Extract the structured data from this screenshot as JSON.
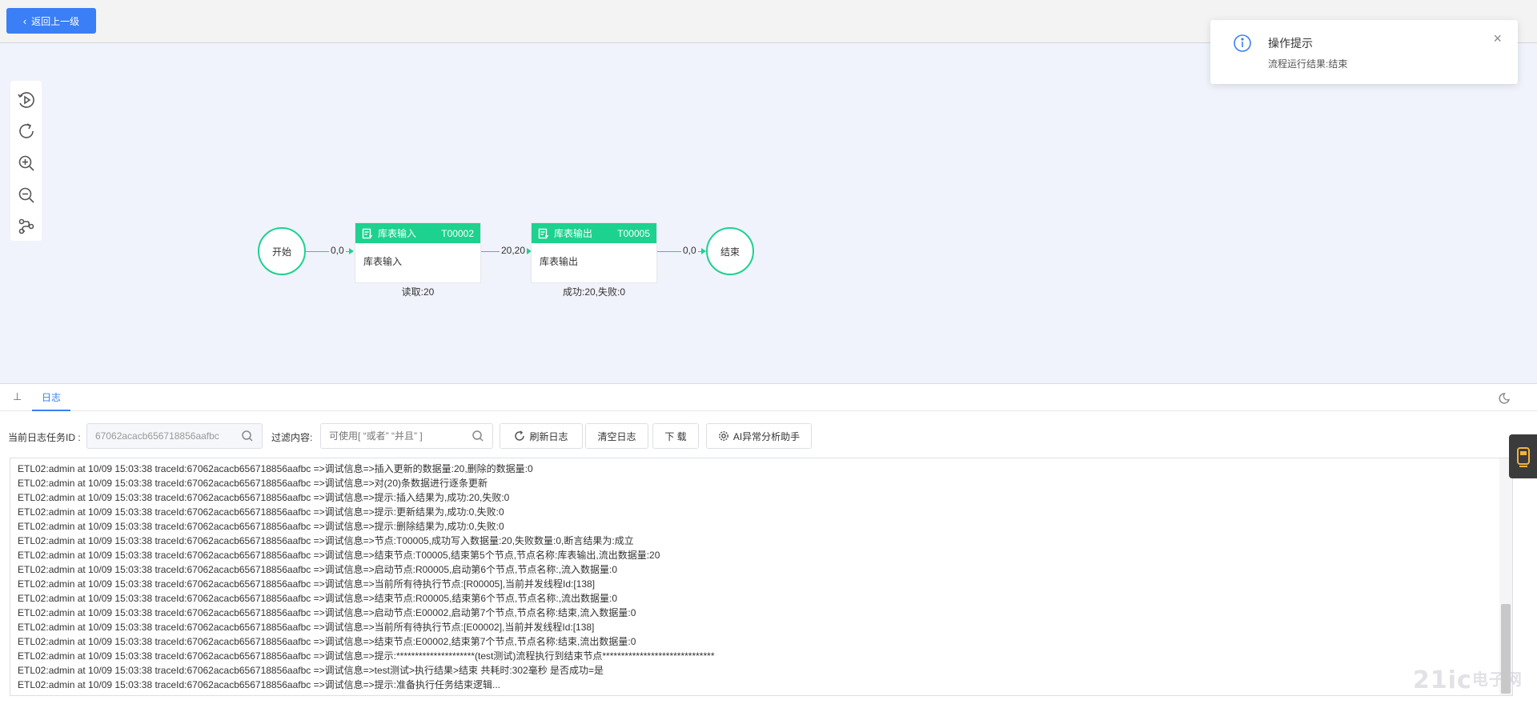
{
  "topbar": {
    "back_label": "返回上一级"
  },
  "toast": {
    "title": "操作提示",
    "message": "流程运行结果:结束",
    "close_glyph": "×"
  },
  "flow": {
    "start_label": "开始",
    "end_label": "结束",
    "edges": [
      "0,0",
      "20,20",
      "0,0"
    ],
    "nodes": [
      {
        "type": "库表输入",
        "id": "T00002",
        "name": "库表输入",
        "stat": "读取:20"
      },
      {
        "type": "库表输出",
        "id": "T00005",
        "name": "库表输出",
        "stat": "成功:20,失败:0"
      }
    ],
    "accent": "#1cd28e"
  },
  "log_panel": {
    "collapse_glyph": "⊥",
    "tab_label": "日志",
    "task_id_label": "当前日志任务ID :",
    "task_id_value": "67062acacb656718856aafbc",
    "filter_label": "过滤内容:",
    "filter_placeholder": "可使用[ “或者” “并且” ]",
    "refresh_label": "刷新日志",
    "clear_label": "清空日志",
    "download_label": "下 载",
    "ai_label": "AI异常分析助手",
    "lines": [
      "ETL02:admin at 10/09 15:03:38 traceId:67062acacb656718856aafbc =>调试信息=>插入更新的数据量:20,删除的数据量:0",
      "ETL02:admin at 10/09 15:03:38 traceId:67062acacb656718856aafbc =>调试信息=>对(20)条数据进行逐条更新",
      "ETL02:admin at 10/09 15:03:38 traceId:67062acacb656718856aafbc =>调试信息=>提示:插入结果为,成功:20,失败:0",
      "ETL02:admin at 10/09 15:03:38 traceId:67062acacb656718856aafbc =>调试信息=>提示:更新结果为,成功:0,失败:0",
      "ETL02:admin at 10/09 15:03:38 traceId:67062acacb656718856aafbc =>调试信息=>提示:删除结果为,成功:0,失败:0",
      "ETL02:admin at 10/09 15:03:38 traceId:67062acacb656718856aafbc =>调试信息=>节点:T00005,成功写入数据量:20,失败数量:0,断言结果为:成立",
      "ETL02:admin at 10/09 15:03:38 traceId:67062acacb656718856aafbc =>调试信息=>结束节点:T00005,结束第5个节点,节点名称:库表输出,流出数据量:20",
      "ETL02:admin at 10/09 15:03:38 traceId:67062acacb656718856aafbc =>调试信息=>启动节点:R00005,启动第6个节点,节点名称:,流入数据量:0",
      "ETL02:admin at 10/09 15:03:38 traceId:67062acacb656718856aafbc =>调试信息=>当前所有待执行节点:[R00005],当前并发线程Id:[138]",
      "ETL02:admin at 10/09 15:03:38 traceId:67062acacb656718856aafbc =>调试信息=>结束节点:R00005,结束第6个节点,节点名称:,流出数据量:0",
      "ETL02:admin at 10/09 15:03:38 traceId:67062acacb656718856aafbc =>调试信息=>启动节点:E00002,启动第7个节点,节点名称:结束,流入数据量:0",
      "ETL02:admin at 10/09 15:03:38 traceId:67062acacb656718856aafbc =>调试信息=>当前所有待执行节点:[E00002],当前并发线程Id:[138]",
      "ETL02:admin at 10/09 15:03:38 traceId:67062acacb656718856aafbc =>调试信息=>结束节点:E00002,结束第7个节点,节点名称:结束,流出数据量:0",
      "ETL02:admin at 10/09 15:03:38 traceId:67062acacb656718856aafbc =>调试信息=>提示:*********************(test测试)流程执行到结束节点******************************",
      "ETL02:admin at 10/09 15:03:38 traceId:67062acacb656718856aafbc =>调试信息=>test测试>执行结果>结束 共耗时:302毫秒 是否成功=是",
      "ETL02:admin at 10/09 15:03:38 traceId:67062acacb656718856aafbc =>调试信息=>提示:准备执行任务结束逻辑..."
    ]
  },
  "watermark": {
    "main": "21ic",
    "sub": "电子网"
  }
}
